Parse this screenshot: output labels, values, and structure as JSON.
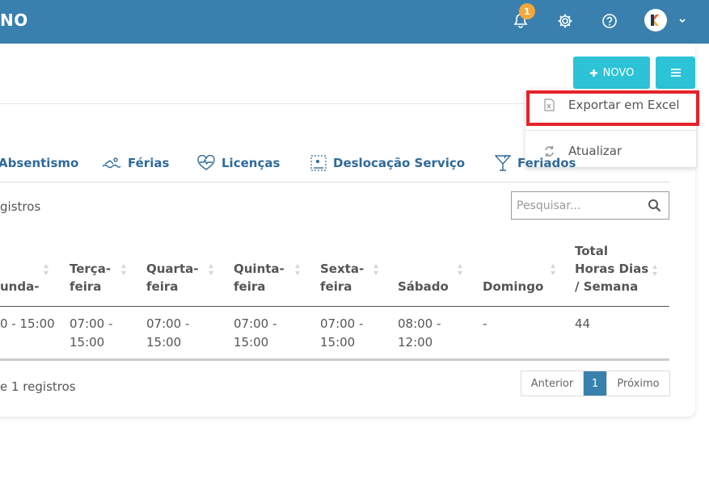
{
  "header": {
    "brand": "NO",
    "notification_count": "1",
    "avatar_letter": "K"
  },
  "toolbar": {
    "novo_label": "NOVO"
  },
  "menu": {
    "export_excel": "Exportar em Excel",
    "refresh": "Atualizar"
  },
  "tabs": [
    {
      "label": "Absentismo",
      "icon": "absence-icon"
    },
    {
      "label": "Férias",
      "icon": "swimmer-icon"
    },
    {
      "label": "Licenças",
      "icon": "heartbeat-icon"
    },
    {
      "label": "Deslocação Serviço",
      "icon": "route-icon"
    },
    {
      "label": "Feriados",
      "icon": "cocktail-icon"
    }
  ],
  "table": {
    "info_top": "gistros",
    "search_placeholder": "Pesquisar...",
    "headers": [
      "unda-",
      "Terça-\nfeira",
      "Quarta-\nfeira",
      "Quinta-\nfeira",
      "Sexta-\nfeira",
      "Sábado",
      "Domingo",
      "Total\nHoras Dias\n/ Semana"
    ],
    "rows": [
      [
        "0 - 15:00",
        "07:00 -\n15:00",
        "07:00 -\n15:00",
        "07:00 -\n15:00",
        "07:00 -\n15:00",
        "08:00 -\n12:00",
        "-",
        "44"
      ]
    ],
    "info_bottom": "e 1 registros"
  },
  "pagination": {
    "prev": "Anterior",
    "current": "1",
    "next": "Próximo"
  },
  "colors": {
    "topbar": "#3a80ae",
    "accent_button": "#2cc3d6",
    "highlight": "#e5222b",
    "tab_text": "#2f6a9a"
  }
}
